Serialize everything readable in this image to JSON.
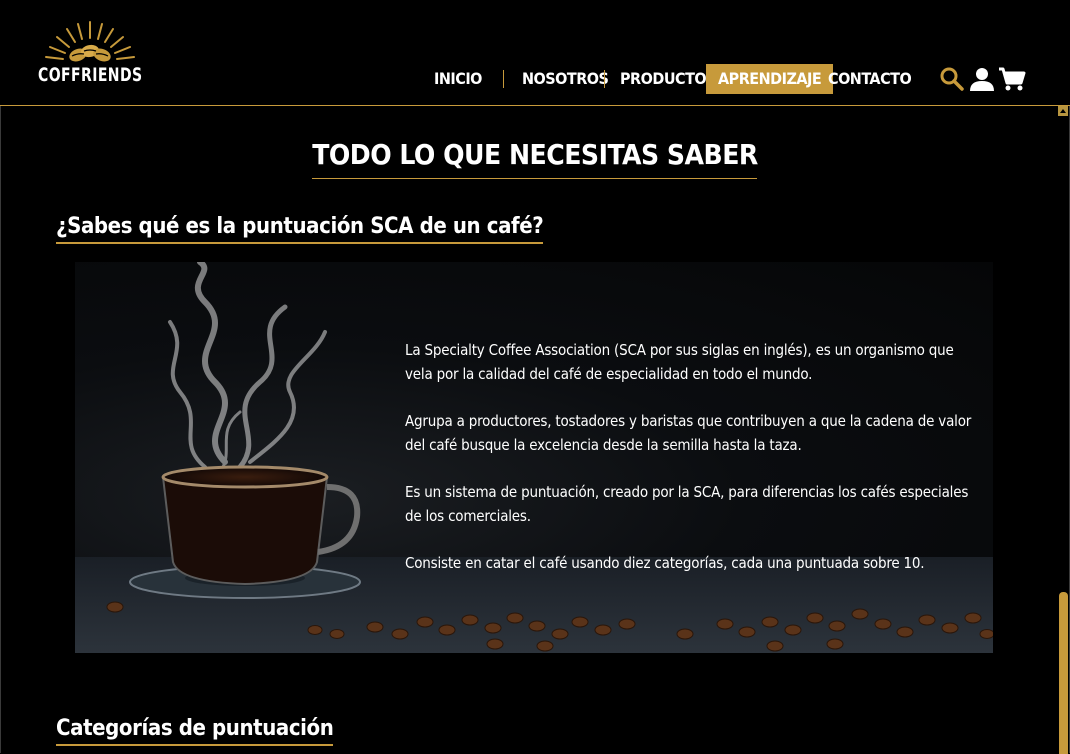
{
  "brand": {
    "name": "COFFRIENDS"
  },
  "nav": {
    "items": [
      {
        "label": "INICIO",
        "active": false
      },
      {
        "label": "NOSOTROS",
        "active": false
      },
      {
        "label": "PRODUCTOS",
        "active": false
      },
      {
        "label": "APRENDIZAJE",
        "active": true
      },
      {
        "label": "CONTACTO",
        "active": false
      }
    ],
    "icons": [
      "search-icon",
      "user-icon",
      "cart-icon"
    ]
  },
  "colors": {
    "accent": "#c79a3b",
    "background": "#000000",
    "text": "#ffffff"
  },
  "main": {
    "section_title": "TODO LO QUE NECESITAS SABER",
    "sca_heading": "¿Sabes qué es la puntuación SCA de un café?",
    "paragraphs": [
      "La Specialty Coffee Association (SCA por sus siglas en inglés), es un organismo que vela por la calidad del café de especialidad en todo el mundo.",
      "Agrupa a productores, tostadores y baristas que contribuyen a que la cadena de valor del café busque la excelencia desde la semilla hasta la taza.",
      "Es un sistema de puntuación, creado por la SCA, para diferencias los cafés especiales de los comerciales.",
      "Consiste en catar el café usando diez categorías, cada una puntuada sobre 10."
    ],
    "categories_heading": "Categorías de puntuación"
  }
}
